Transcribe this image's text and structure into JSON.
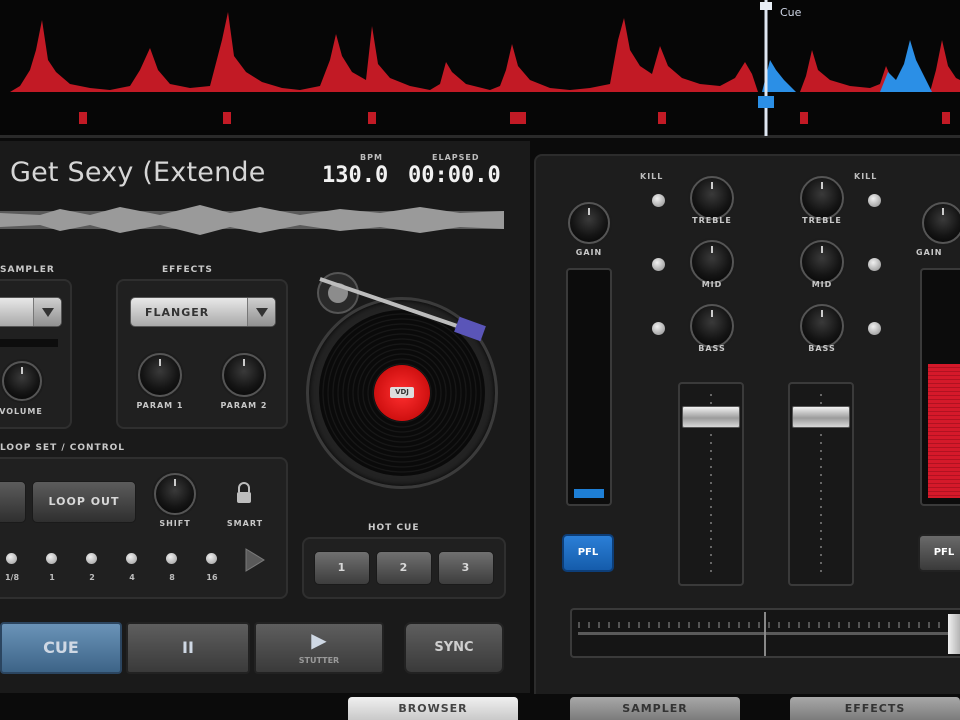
{
  "waveform": {
    "cue_label": "Cue"
  },
  "deck": {
    "track_title": "Get Sexy (Extende",
    "bpm_label": "BPM",
    "bpm_value": "130.0",
    "elapsed_label": "ELAPSED",
    "elapsed_value": "00:00.0",
    "sampler": {
      "label": "SAMPLER",
      "volume_label": "VOLUME"
    },
    "effects": {
      "label": "EFFECTS",
      "effect_selected": "FLANGER",
      "param1_label": "PARAM 1",
      "param2_label": "PARAM 2"
    },
    "loop": {
      "label": "LOOP SET / CONTROL",
      "loop_out_label": "LOOP OUT",
      "shift_label": "SHIFT",
      "smart_label": "SMART",
      "lengths": [
        "1/8",
        "1",
        "2",
        "4",
        "8",
        "16"
      ]
    },
    "hot_cue": {
      "label": "HOT CUE",
      "buttons": [
        "1",
        "2",
        "3"
      ]
    },
    "transport": {
      "cue_label": "CUE",
      "pause_label": "II",
      "play_label": "▶",
      "stutter_label": "STUTTER",
      "sync_label": "SYNC"
    }
  },
  "mixer": {
    "kill_label_left": "KILL",
    "kill_label_right": "KILL",
    "gain_label": "GAIN",
    "treble_label": "TREBLE",
    "mid_label": "MID",
    "bass_label": "BASS",
    "pfl_label": "PFL",
    "vu_left_level": 0.04,
    "vu_right_level": 0.6
  },
  "tabs": [
    "BROWSER",
    "SAMPLER",
    "EFFECTS"
  ],
  "colors": {
    "wave_red": "#c21a25",
    "wave_blue": "#2b8fe6",
    "pfl_blue": "#1a6ac4",
    "cue_blue": "#4f7aa3"
  }
}
